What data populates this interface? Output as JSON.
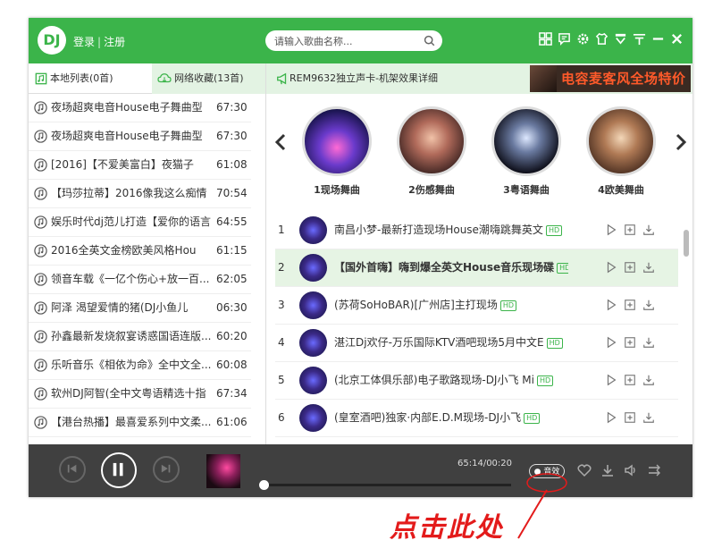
{
  "header": {
    "logo": "DJ",
    "login": "登录",
    "separator": "|",
    "register": "注册",
    "search_placeholder": "请输入歌曲名称...",
    "icons": [
      "grid-icon",
      "comment-icon",
      "settings-icon",
      "skin-icon",
      "download-manager-icon",
      "network-icon",
      "minimize-icon",
      "close-icon"
    ]
  },
  "sidebar": {
    "tab_local": "本地列表(0首)",
    "tab_net": "网络收藏(13首)",
    "items": [
      {
        "title": "夜场超爽电音House电子舞曲型",
        "duration": "67:30"
      },
      {
        "title": "夜场超爽电音House电子舞曲型",
        "duration": "67:30"
      },
      {
        "title": "[2016]【不爱美富白】夜猫子",
        "duration": "61:08"
      },
      {
        "title": "【玛莎拉蒂】2016像我这么痴情",
        "duration": "70:54"
      },
      {
        "title": "娱乐时代dj范儿打造【爱你的语言",
        "duration": "64:55"
      },
      {
        "title": "2016全英文金榜欧美风格Hou",
        "duration": "61:15"
      },
      {
        "title": "领音车载《一亿个伤心+放一百...",
        "duration": "62:05"
      },
      {
        "title": "阿泽 渴望爱情的猪(DJ小鱼儿",
        "duration": "06:30"
      },
      {
        "title": "孙鑫最新发烧叙宴诱惑国语连版...",
        "duration": "60:20"
      },
      {
        "title": "乐听音乐《相依为命》全中文全...",
        "duration": "60:08"
      },
      {
        "title": "软州DJ阿智(全中文粤语精选十指",
        "duration": "67:34"
      },
      {
        "title": "【港台热播】最喜爱系列中文柔...",
        "duration": "61:06"
      }
    ]
  },
  "main": {
    "info_title": "REM9632独立声卡-机架效果详细",
    "ad_text": "电容麦客风全场特价",
    "categories": [
      "1现场舞曲",
      "2伤感舞曲",
      "3粤语舞曲",
      "4欧美舞曲"
    ],
    "hd_badge": "HD",
    "songs": [
      {
        "num": "1",
        "title": "南昌小梦-最新打造现场House潮嗨跳舞英文",
        "active": false
      },
      {
        "num": "2",
        "title": "【国外首嗨】嗨到爆全英文House音乐现场碟",
        "active": true
      },
      {
        "num": "3",
        "title": "(苏荷SoHoBAR)[广州店]主打现场",
        "active": false
      },
      {
        "num": "4",
        "title": "湛江Dj欢仔-万乐国际KTV酒吧现场5月中文E",
        "active": false
      },
      {
        "num": "5",
        "title": "(北京工体俱乐部)电子歌路现场-DJ小飞 Mi",
        "active": false
      },
      {
        "num": "6",
        "title": "(皇室酒吧)独家·内部E.D.M现场-DJ小飞",
        "active": false
      }
    ]
  },
  "player": {
    "time": "65:14/00:20",
    "progress": 0.0,
    "sound_effect": "● 音效"
  },
  "annotation": {
    "text": "点击此处",
    "color": "#e31b1b"
  },
  "colors": {
    "brand_green": "#3bb44a",
    "player_bg": "#404040",
    "active_row": "#e6f4e4"
  }
}
